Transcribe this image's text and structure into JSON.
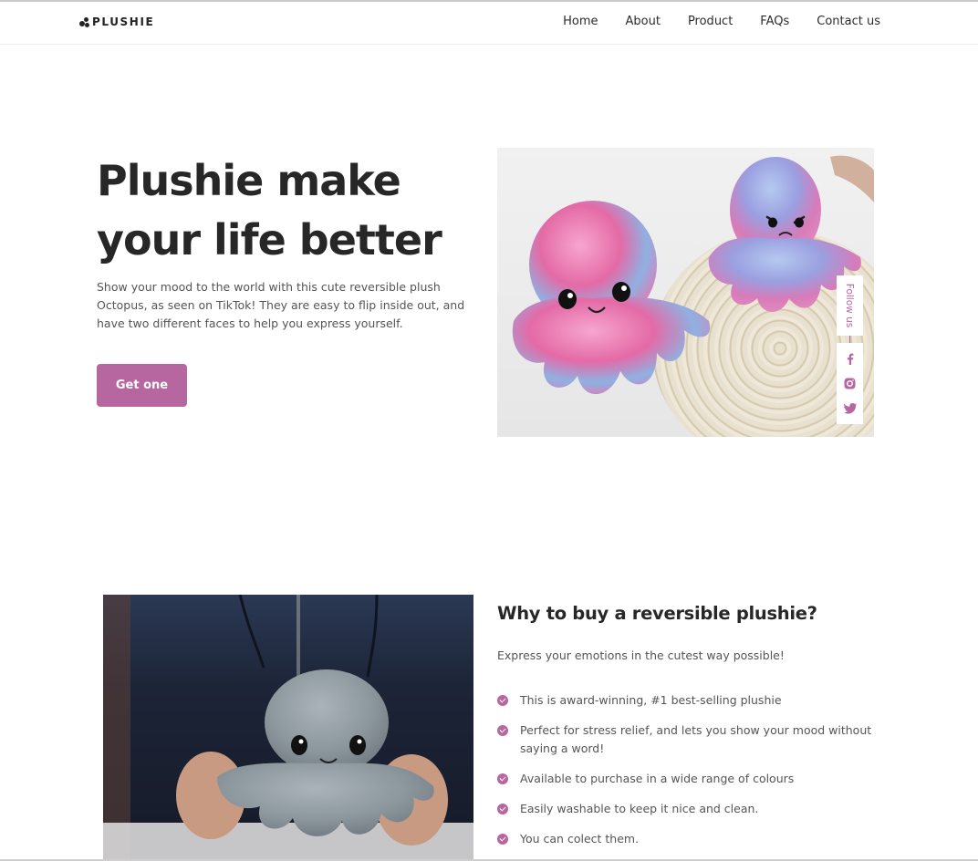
{
  "brand": {
    "name": "PLUSHIE",
    "accent": "#b7679f"
  },
  "nav": {
    "items": [
      {
        "label": "Home"
      },
      {
        "label": "About"
      },
      {
        "label": "Product"
      },
      {
        "label": "FAQs"
      },
      {
        "label": "Contact us"
      }
    ]
  },
  "hero": {
    "title_line1": "Plushie make",
    "title_line2": "your life better",
    "description": "Show your mood to the world with this cute reversible plush Octopus, as seen on TikTok! They are easy to flip inside out, and have two different faces to help you express yourself.",
    "cta_label": "Get one",
    "image_alt": "Two reversible octopus plushies on a woven mat"
  },
  "follow": {
    "label": "Follow us",
    "icons": [
      "facebook-icon",
      "instagram-icon",
      "twitter-icon"
    ]
  },
  "why": {
    "title": "Why to buy a reversible plushie?",
    "subtitle": "Express your emotions in the cutest way possible!",
    "points": [
      "This is award-winning, #1 best-selling plushie",
      "Perfect for stress relief, and lets you show your mood without saying a word!",
      "Available to purchase in a wide range of colours",
      "Easily washable to keep it nice and clean.",
      "You can colect them."
    ],
    "image_alt": "Person holding a grey octopus plushie"
  }
}
